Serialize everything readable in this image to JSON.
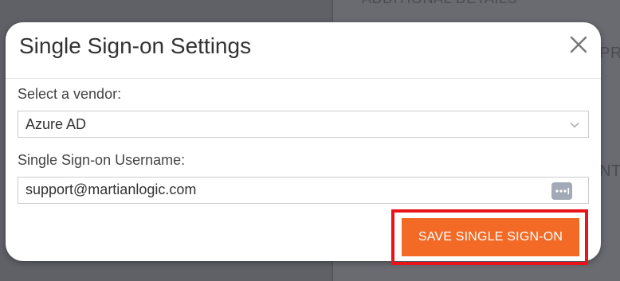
{
  "background": {
    "header_fragment": "ADDITIONAL DETAILS",
    "fragment_1": "PR",
    "fragment_2": "NT"
  },
  "modal": {
    "title": "Single Sign-on Settings",
    "close_icon": "close-icon",
    "vendor_label": "Select a vendor:",
    "vendor_value": "Azure AD",
    "vendor_dropdown_icon": "chevron-down-icon",
    "username_label": "Single Sign-on Username:",
    "username_value": "support@martianlogic.com",
    "password_manager_icon": "password-dots-icon",
    "save_label": "SAVE SINGLE SIGN-ON"
  },
  "colors": {
    "accent": "#f26a25",
    "highlight": "#e8141a",
    "overlay": "#606167"
  }
}
